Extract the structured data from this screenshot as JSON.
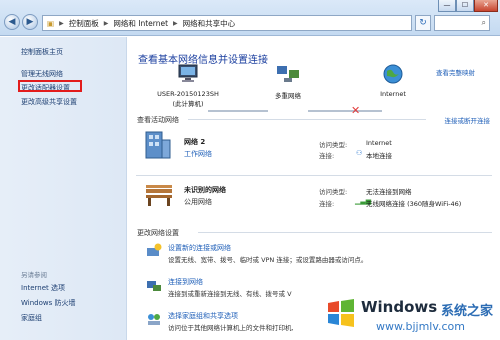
{
  "addressbar": {
    "crumbs": [
      "控制面板",
      "网络和 Internet",
      "网络和共享中心"
    ],
    "search_icon": "search-icon",
    "refresh_icon": "refresh-icon"
  },
  "window_controls": {
    "minimize": "—",
    "maximize": "☐",
    "close": "✕"
  },
  "sidebar": {
    "home": "控制面板主页",
    "items": [
      "管理无线网络",
      "更改适配器设置",
      "更改高级共享设置"
    ],
    "see_also_title": "另请参阅",
    "see_also": [
      "Internet 选项",
      "Windows 防火墙",
      "家庭组"
    ]
  },
  "main": {
    "title": "查看基本网络信息并设置连接",
    "full_map_link": "查看完整映射",
    "map": {
      "computer_label": "USER-20150123SH",
      "computer_sublabel": "(此计算机)",
      "network_label": "多重网络",
      "internet_label": "Internet"
    },
    "active_header": "查看活动网络",
    "connect_link": "连接或断开连接",
    "networks": [
      {
        "name": "网络  2",
        "category": "工作网络",
        "access_key": "访问类型:",
        "access_value": "Internet",
        "conn_key": "连接:",
        "conn_value": "本地连接"
      },
      {
        "name": "未识别的网络",
        "category": "公用网络",
        "access_key": "访问类型:",
        "access_value": "无法连接到网络",
        "conn_key": "连接:",
        "conn_value": "无线网络连接 (360随身WiFi-46)"
      }
    ],
    "change_header": "更改网络设置",
    "tasks": [
      {
        "label": "设置新的连接或网络",
        "desc": "设置无线、宽带、拨号、临时或 VPN 连接；或设置路由器或访问点。"
      },
      {
        "label": "连接到网络",
        "desc": "连接到或重新连接到无线、有线、拨号或 V"
      },
      {
        "label": "选择家庭组和共享选项",
        "desc": "访问位于其他网络计算机上的文件和打印机,"
      }
    ]
  },
  "watermark": {
    "brand": "Windows",
    "cn": "系统之家",
    "url": "www.bjjmlv.com"
  },
  "colors": {
    "accent": "#1f5fb8",
    "highlight": "#e21c1c",
    "title": "#1a3e9f"
  }
}
